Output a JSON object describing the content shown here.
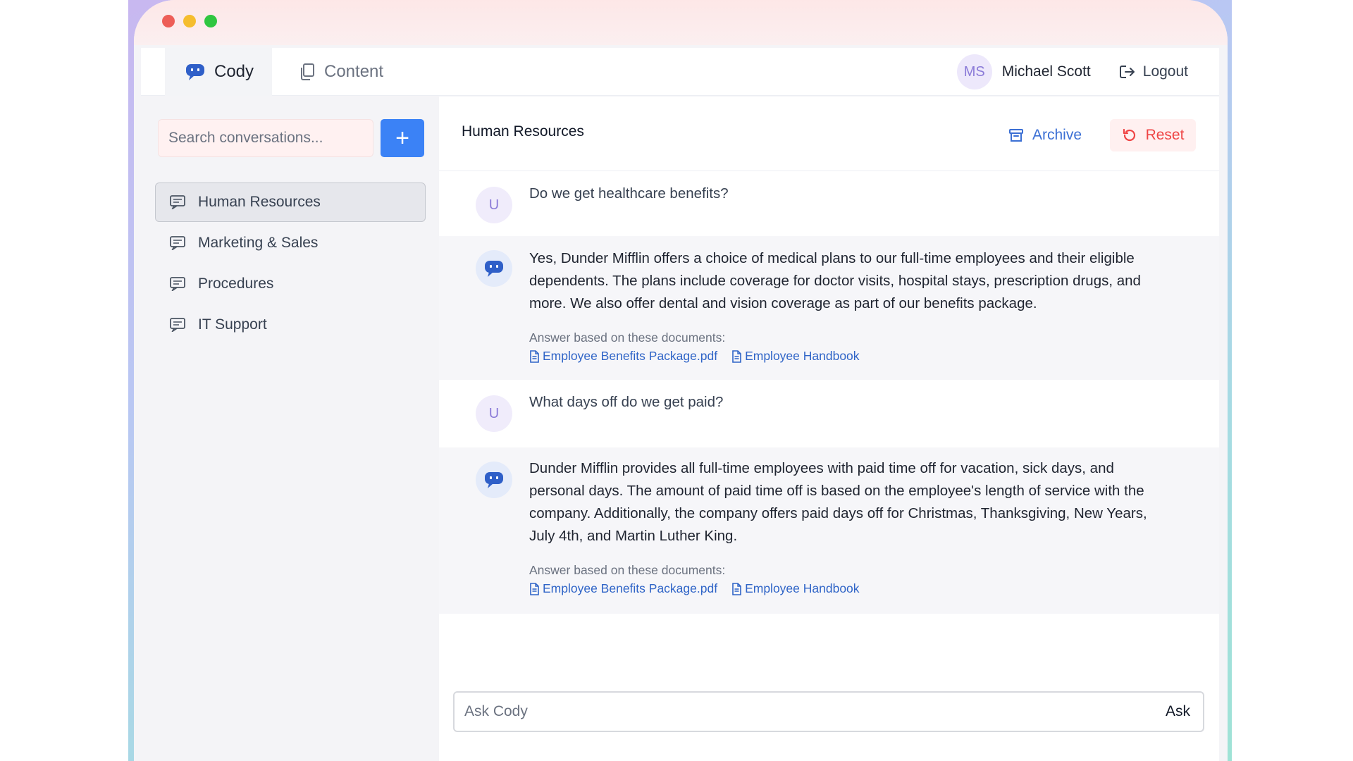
{
  "window": {
    "controls": [
      "close",
      "minimize",
      "maximize"
    ],
    "colors": {
      "close": "#ed5e57",
      "minimize": "#f5bd2e",
      "maximize": "#2fc640"
    }
  },
  "nav": {
    "tabs": [
      {
        "label": "Cody",
        "icon": "chat-bubble-icon",
        "active": true
      },
      {
        "label": "Content",
        "icon": "documents-icon",
        "active": false
      }
    ],
    "user": {
      "initials": "MS",
      "name": "Michael Scott"
    },
    "logout_label": "Logout"
  },
  "sidebar": {
    "search_placeholder": "Search conversations...",
    "add_label": "+",
    "conversations": [
      {
        "label": "Human Resources",
        "active": true
      },
      {
        "label": "Marketing & Sales",
        "active": false
      },
      {
        "label": "Procedures",
        "active": false
      },
      {
        "label": "IT Support",
        "active": false
      }
    ]
  },
  "chat": {
    "title": "Human Resources",
    "archive_label": "Archive",
    "reset_label": "Reset",
    "accent": "#3b82f6",
    "messages": [
      {
        "role": "user",
        "avatar": "U",
        "text": "Do we get healthcare benefits?"
      },
      {
        "role": "bot",
        "text": "Yes, Dunder Mifflin offers a choice of medical plans to our full-time employees and their eligible dependents. The plans include coverage for doctor visits, hospital stays, prescription drugs, and more. We also offer dental and vision coverage as part of our benefits package.",
        "sources_label": "Answer based on these documents:",
        "sources": [
          "Employee Benefits Package.pdf",
          "Employee Handbook"
        ]
      },
      {
        "role": "user",
        "avatar": "U",
        "text": "What days off do we get paid?"
      },
      {
        "role": "bot",
        "text": "Dunder Mifflin provides all full-time employees with paid time off for vacation, sick days, and personal days. The amount of paid time off is based on the employee's length of service with the company. Additionally, the company offers paid days off for Christmas, Thanksgiving, New Years, July 4th, and Martin Luther King.",
        "sources_label": "Answer based on these documents:",
        "sources": [
          "Employee Benefits Package.pdf",
          "Employee Handbook"
        ]
      }
    ],
    "input_placeholder": "Ask Cody",
    "ask_label": "Ask"
  }
}
